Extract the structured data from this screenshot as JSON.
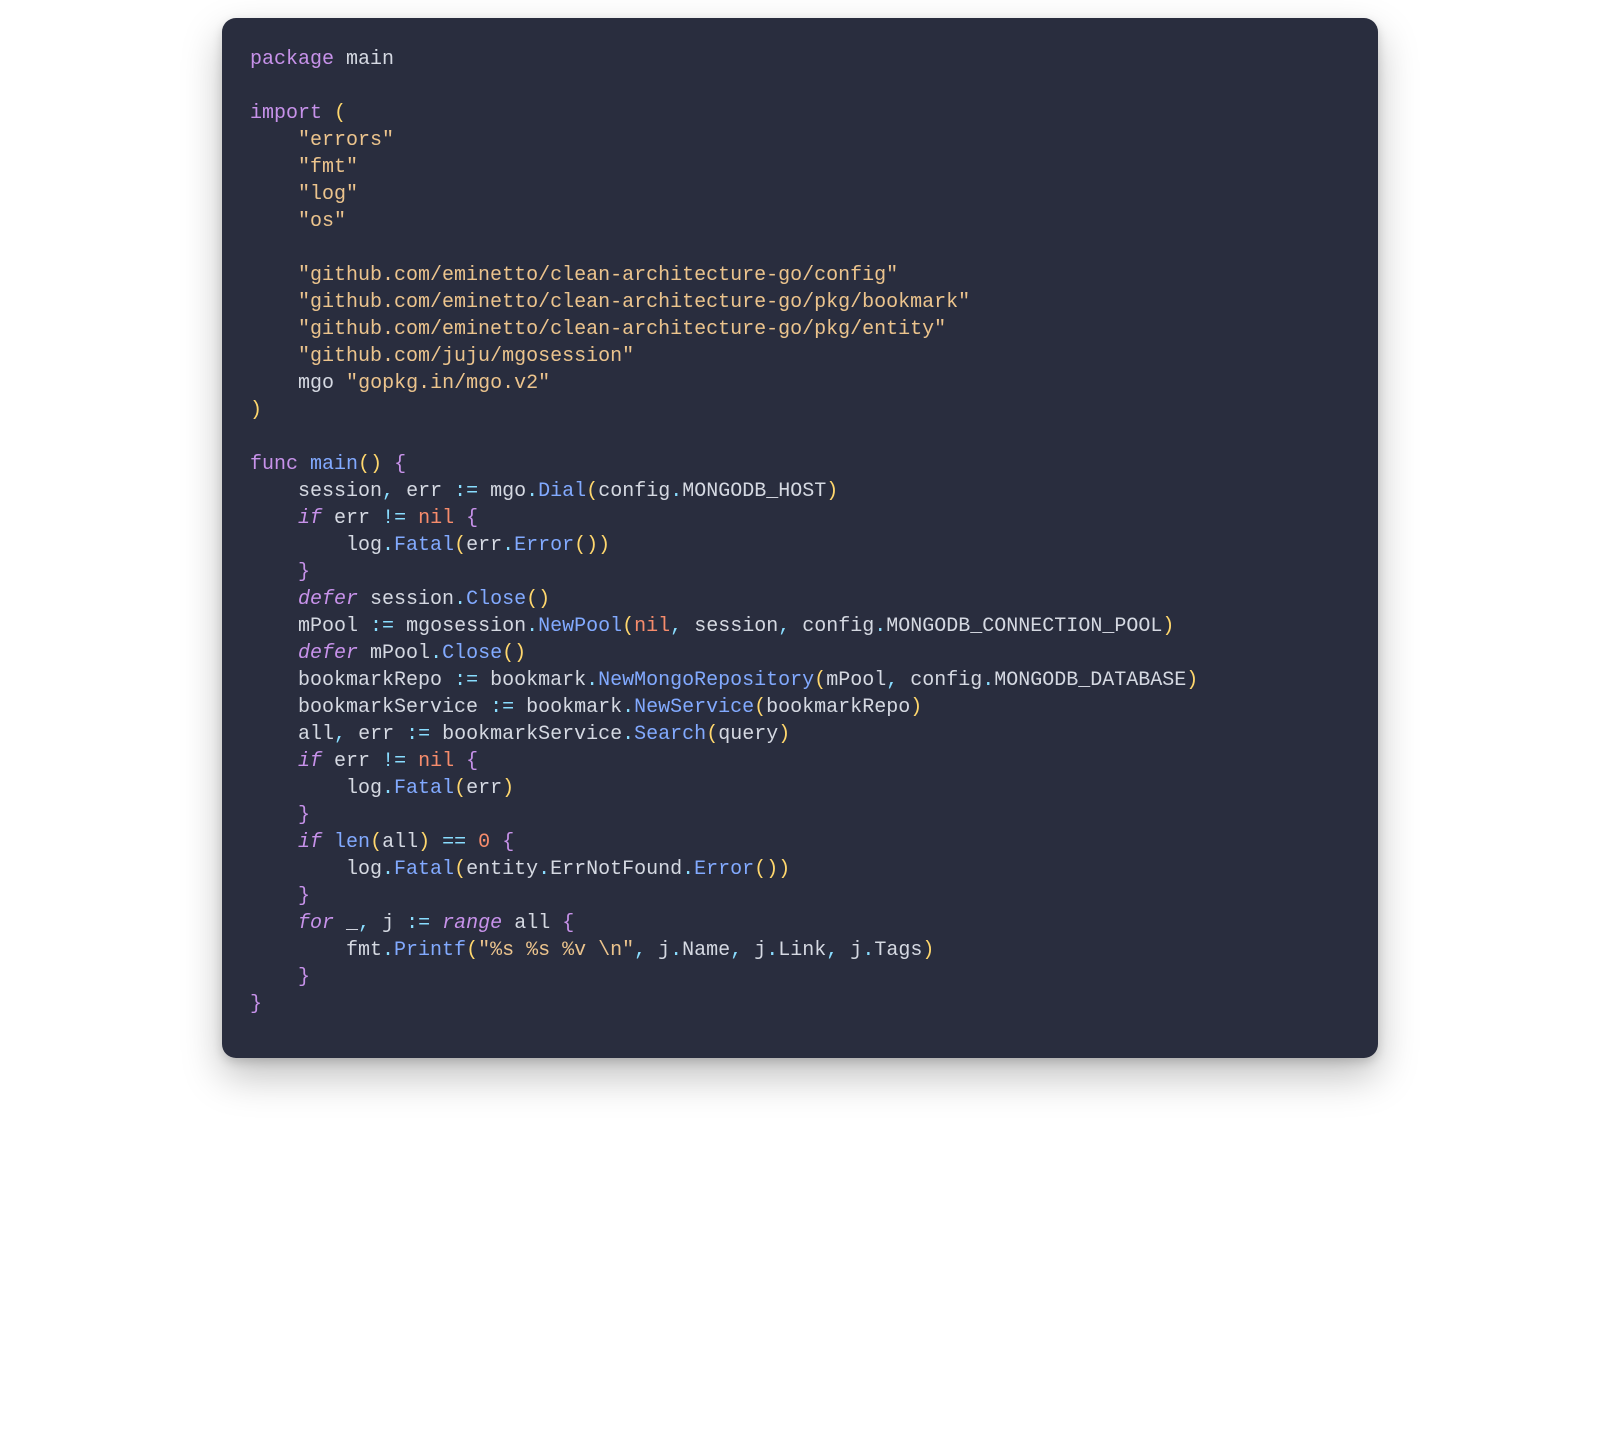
{
  "code": {
    "language": "go",
    "package_name": "main",
    "imports": [
      "errors",
      "fmt",
      "log",
      "os",
      "github.com/eminetto/clean-architecture-go/config",
      "github.com/eminetto/clean-architecture-go/pkg/bookmark",
      "github.com/eminetto/clean-architecture-go/pkg/entity",
      "github.com/juju/mgosession"
    ],
    "aliased_import": {
      "alias": "mgo",
      "path": "gopkg.in/mgo.v2"
    },
    "function_name": "main",
    "tokens": {
      "kw_package": "package",
      "kw_import": "import",
      "kw_func": "func",
      "kw_if": "if",
      "kw_defer": "defer",
      "kw_for": "for",
      "kw_range": "range",
      "nil": "nil",
      "zero": "0",
      "op_decl": ":=",
      "op_ne": "!=",
      "op_eq": "==",
      "session": "session",
      "err": "err",
      "mgo": "mgo",
      "Dial": "Dial",
      "config": "config",
      "MONGODB_HOST": "MONGODB_HOST",
      "log": "log",
      "Fatal": "Fatal",
      "Error": "Error",
      "Close": "Close",
      "mPool": "mPool",
      "mgosession": "mgosession",
      "NewPool": "NewPool",
      "MONGODB_CONNECTION_POOL": "MONGODB_CONNECTION_POOL",
      "bookmarkRepo": "bookmarkRepo",
      "bookmark": "bookmark",
      "NewMongoRepository": "NewMongoRepository",
      "MONGODB_DATABASE": "MONGODB_DATABASE",
      "bookmarkService": "bookmarkService",
      "NewService": "NewService",
      "all": "all",
      "Search": "Search",
      "query": "query",
      "len": "len",
      "entity": "entity",
      "ErrNotFound": "ErrNotFound",
      "underscore": "_",
      "j": "j",
      "fmt": "fmt",
      "Printf": "Printf",
      "fmt_string": "\"%s %s %v \\n\"",
      "Name": "Name",
      "Link": "Link",
      "Tags": "Tags",
      "lparen": "(",
      "rparen": ")",
      "lbrace": "{",
      "rbrace": "}",
      "dot": ".",
      "comma": ",",
      "space": " "
    }
  }
}
